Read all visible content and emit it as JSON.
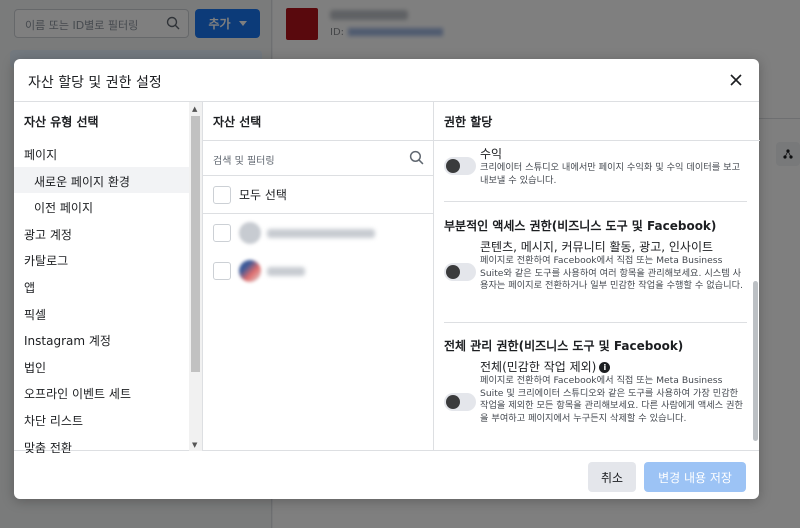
{
  "background": {
    "search_placeholder": "이름 또는 ID별로 필터링",
    "add_button_label": "추가",
    "asset_id_prefix": "ID:"
  },
  "modal": {
    "title": "자산 할당 및 권한 설정",
    "asset_types": {
      "header": "자산 유형 선택",
      "items": [
        {
          "label": "페이지",
          "sub": false,
          "selected": false
        },
        {
          "label": "새로운 페이지 환경",
          "sub": true,
          "selected": true
        },
        {
          "label": "이전 페이지",
          "sub": true,
          "selected": false
        },
        {
          "label": "광고 계정",
          "sub": false,
          "selected": false
        },
        {
          "label": "카탈로그",
          "sub": false,
          "selected": false
        },
        {
          "label": "앱",
          "sub": false,
          "selected": false
        },
        {
          "label": "픽셀",
          "sub": false,
          "selected": false
        },
        {
          "label": "Instagram 계정",
          "sub": false,
          "selected": false
        },
        {
          "label": "법인",
          "sub": false,
          "selected": false
        },
        {
          "label": "오프라인 이벤트 세트",
          "sub": false,
          "selected": false
        },
        {
          "label": "차단 리스트",
          "sub": false,
          "selected": false
        },
        {
          "label": "맞춤 전환",
          "sub": false,
          "selected": false
        }
      ]
    },
    "assets": {
      "header": "자산 선택",
      "search_placeholder": "검색 및 필터링",
      "select_all_label": "모두 선택"
    },
    "permissions": {
      "header": "권한 할당",
      "revenue": {
        "name": "수익",
        "desc": "크리에이터 스튜디오 내에서만 페이지 수익화 및 수익 데이터를 보고 내보낼 수 있습니다."
      },
      "partial": {
        "title": "부분적인 액세스 권한(비즈니스 도구 및 Facebook)",
        "name": "콘텐츠, 메시지, 커뮤니티 활동, 광고, 인사이트",
        "desc": "페이지로 전환하여 Facebook에서 직접 또는 Meta Business Suite와 같은 도구를 사용하여 여러 항목을 관리해보세요. 시스템 사용자는 페이지로 전환하거나 일부 민감한 작업을 수행할 수 없습니다."
      },
      "full": {
        "title": "전체 관리 권한(비즈니스 도구 및 Facebook)",
        "name": "전체(민감한 작업 제외)",
        "desc": "페이지로 전환하여 Facebook에서 직접 또는 Meta Business Suite 및 크리에이터 스튜디오와 같은 도구를 사용하여 가장 민감한 작업을 제외한 모든 항목을 관리해보세요. 다른 사람에게 액세스 권한을 부여하고 페이지에서 누구든지 삭제할 수 있습니다."
      }
    },
    "cancel_label": "취소",
    "save_label": "변경 내용 저장"
  }
}
